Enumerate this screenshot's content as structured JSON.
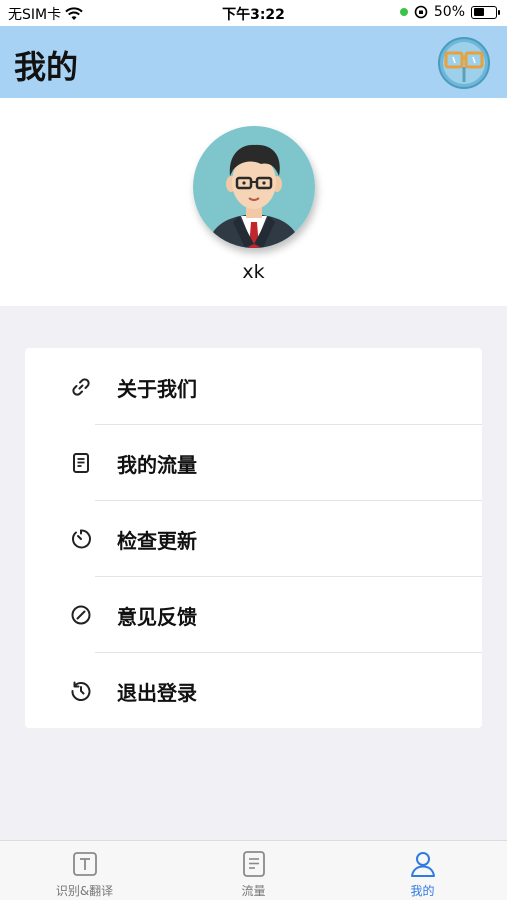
{
  "status_bar": {
    "carrier": "无SIM卡",
    "time": "下午3:22",
    "battery_percent": "50%",
    "battery_level": 0.5
  },
  "header": {
    "title": "我的"
  },
  "profile": {
    "username": "xk"
  },
  "menu": {
    "items": [
      {
        "label": "关于我们",
        "icon": "link-icon"
      },
      {
        "label": "我的流量",
        "icon": "document-icon"
      },
      {
        "label": "检查更新",
        "icon": "timer-icon"
      },
      {
        "label": "意见反馈",
        "icon": "slash-circle-icon"
      },
      {
        "label": "退出登录",
        "icon": "history-icon"
      }
    ]
  },
  "tab_bar": {
    "tabs": [
      {
        "label": "识别&翻译",
        "icon": "text-box-icon",
        "active": false
      },
      {
        "label": "流量",
        "icon": "document-icon",
        "active": false
      },
      {
        "label": "我的",
        "icon": "person-icon",
        "active": true
      }
    ]
  },
  "colors": {
    "header_bg": "#a8d2f3",
    "accent": "#2f7be0",
    "page_bg": "#f0f0f5"
  }
}
